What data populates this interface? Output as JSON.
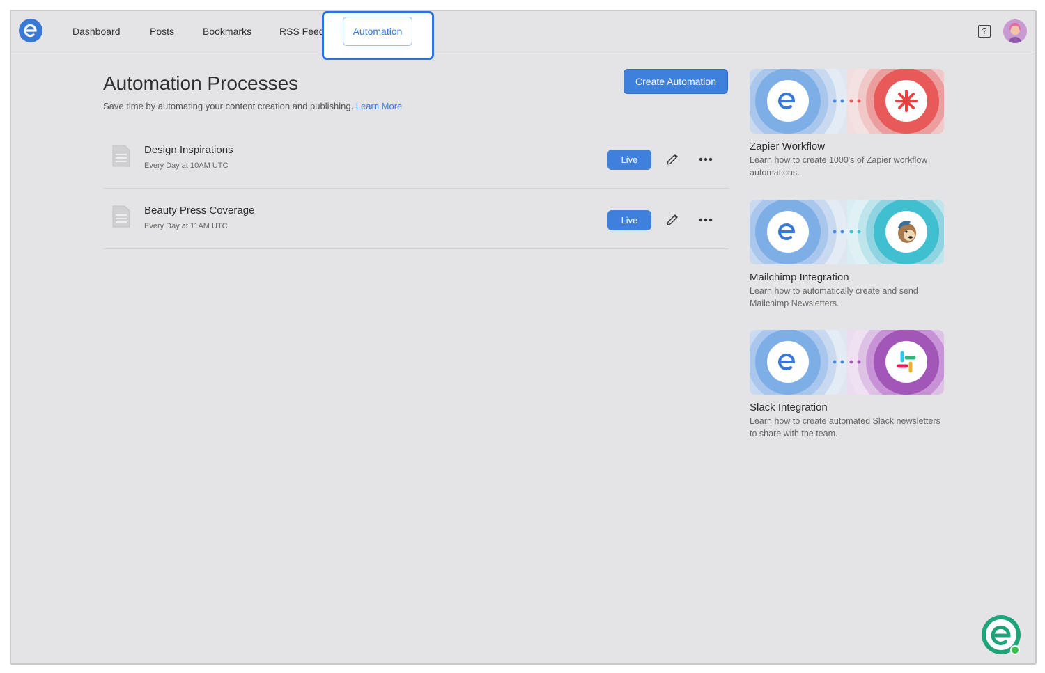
{
  "nav": {
    "items": [
      "Dashboard",
      "Posts",
      "Bookmarks",
      "RSS Feeds"
    ],
    "active": "Automation",
    "help_symbol": "?"
  },
  "header": {
    "title": "Automation Processes",
    "subtitle": "Save time by automating your content creation and publishing.",
    "learn_more": "Learn More",
    "create_button": "Create Automation"
  },
  "automations": [
    {
      "name": "Design Inspirations",
      "schedule": "Every Day at 10AM UTC",
      "status": "Live"
    },
    {
      "name": "Beauty Press Coverage",
      "schedule": "Every Day at 11AM UTC",
      "status": "Live"
    }
  ],
  "integrations": [
    {
      "title": "Zapier Workflow",
      "description": "Learn how to create 1000's of Zapier workflow automations.",
      "icon": "zapier-icon",
      "color": "#e8595a"
    },
    {
      "title": "Mailchimp Integration",
      "description": "Learn how to automatically create and send Mailchimp Newsletters.",
      "icon": "mailchimp-icon",
      "color": "#3fbfd0"
    },
    {
      "title": "Slack Integration",
      "description": "Learn how to create automated Slack newsletters to share with the team.",
      "icon": "slack-icon",
      "color": "#a257b8"
    }
  ],
  "colors": {
    "accent": "#3f80dc",
    "brand_green": "#1fa37a",
    "highlight": "#2d72e0"
  }
}
